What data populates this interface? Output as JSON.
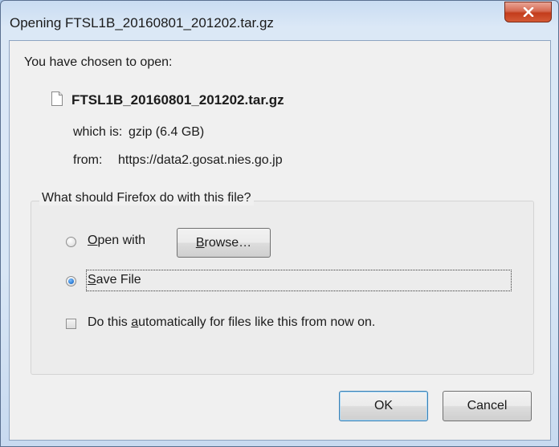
{
  "window": {
    "title": "Opening FTSL1B_20160801_201202.tar.gz"
  },
  "dialog": {
    "prompt": "You have chosen to open:",
    "filename": "FTSL1B_20160801_201202.tar.gz",
    "which_is_label": "which is:",
    "which_is_value": "gzip (6.4 GB)",
    "from_label": "from:",
    "from_value": "https://data2.gosat.nies.go.jp"
  },
  "action_group": {
    "label": "What should Firefox do with this file?",
    "open_with": {
      "mnemonic": "O",
      "rest": "pen with",
      "selected": false
    },
    "browse": {
      "mnemonic": "B",
      "rest": "rowse…"
    },
    "save_file": {
      "mnemonic": "S",
      "rest": "ave File",
      "selected": true
    },
    "auto": {
      "before": "Do this ",
      "mnemonic": "a",
      "after": "utomatically for files like this from now on.",
      "checked": false
    }
  },
  "buttons": {
    "ok": "OK",
    "cancel": "Cancel"
  },
  "colors": {
    "close_button": "#c33c1c",
    "radio_selected": "#2f7fd7"
  },
  "icons": {
    "close": "close-x-icon",
    "file": "file-icon"
  }
}
